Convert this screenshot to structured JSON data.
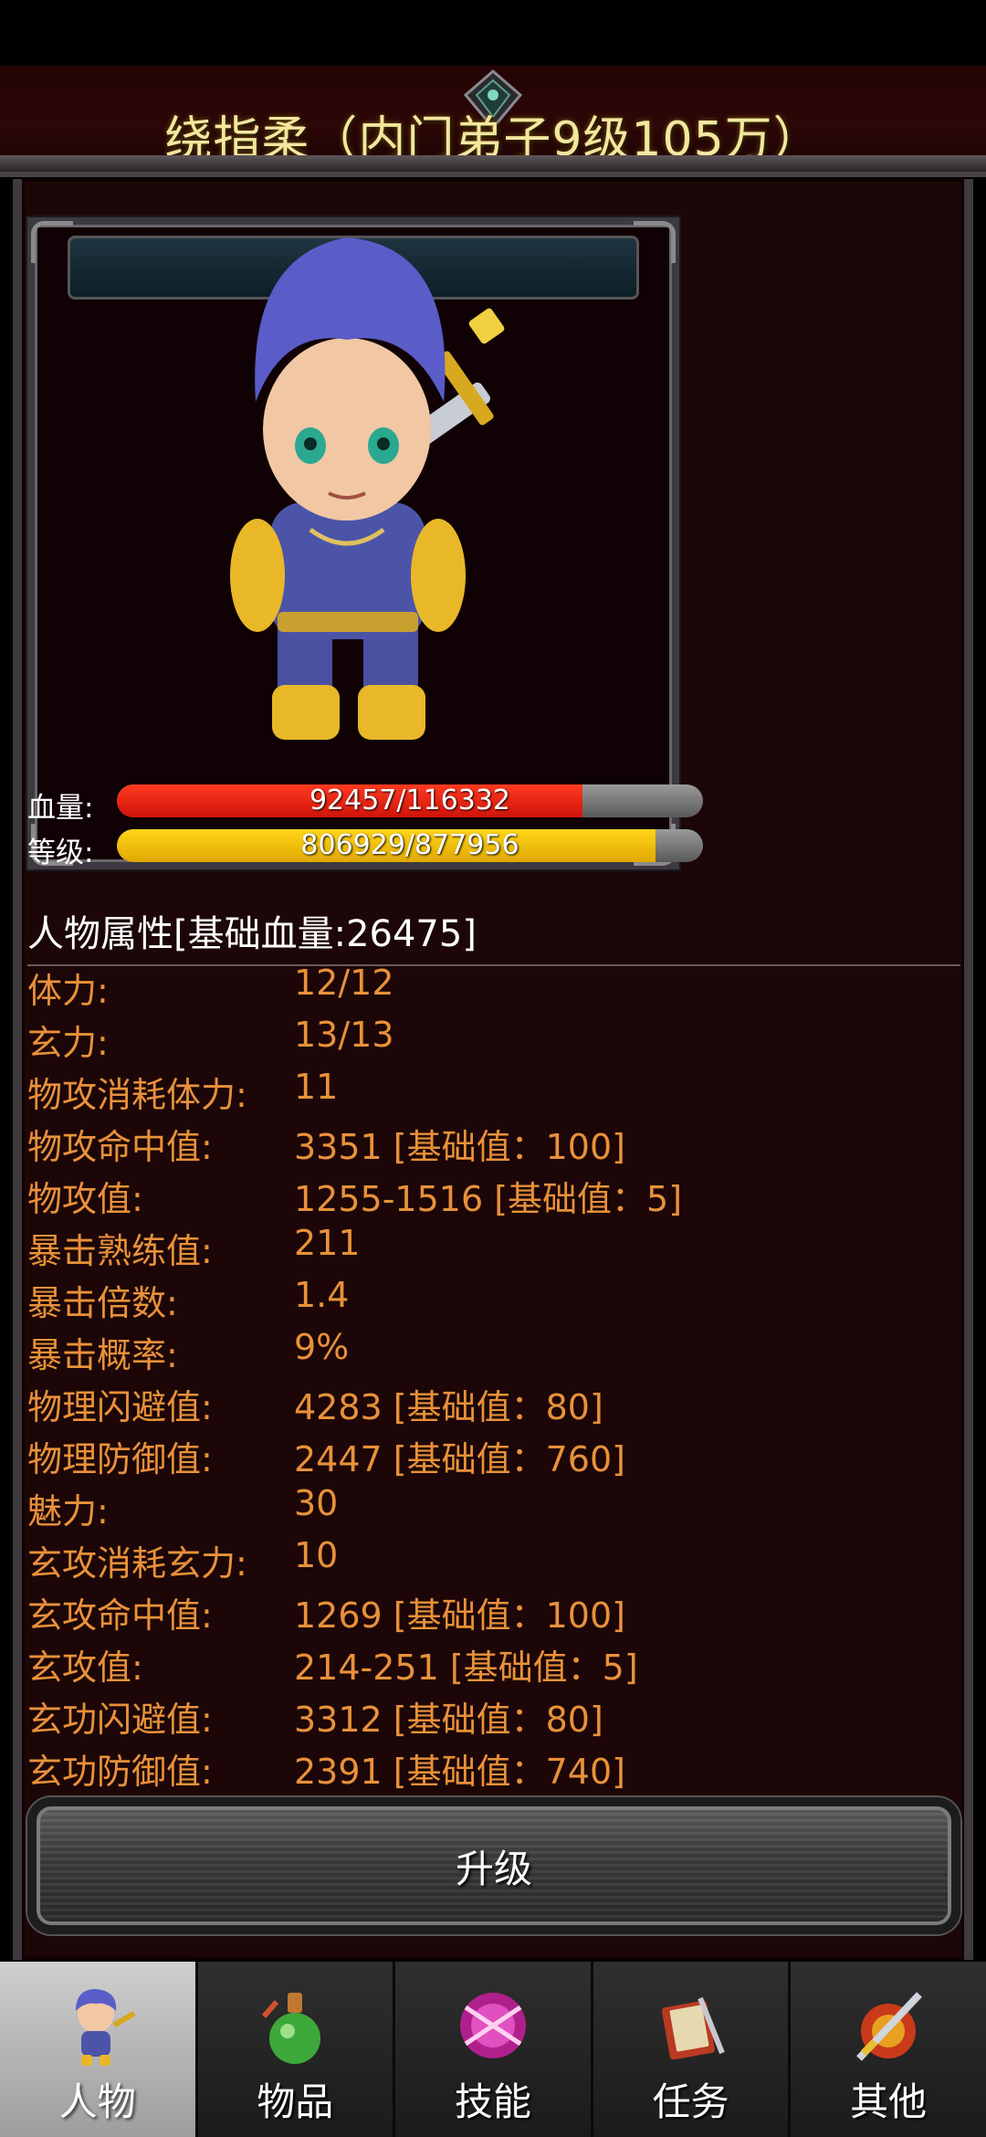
{
  "header": {
    "title": "绕指柔（内门弟子9级105万）"
  },
  "stats": {
    "hp_label": "血量:",
    "hp_text": "92457/116332",
    "hp_fraction": 0.7948,
    "level_label": "等级:",
    "level_text": "806929/877956",
    "level_fraction": 0.9191
  },
  "attributes": {
    "header": "人物属性[基础血量:26475]",
    "rows": [
      {
        "name": "体力:",
        "value": "12/12"
      },
      {
        "name": "玄力:",
        "value": "13/13"
      },
      {
        "name": "物攻消耗体力:",
        "value": "11"
      },
      {
        "name": "物攻命中值:",
        "value": "3351 [基础值：100]"
      },
      {
        "name": "物攻值:",
        "value": "1255-1516 [基础值：5]"
      },
      {
        "name": "暴击熟练值:",
        "value": "211"
      },
      {
        "name": "暴击倍数:",
        "value": "1.4"
      },
      {
        "name": "暴击概率:",
        "value": "9%"
      },
      {
        "name": "物理闪避值:",
        "value": "4283 [基础值：80]"
      },
      {
        "name": "物理防御值:",
        "value": "2447 [基础值：760]"
      },
      {
        "name": "魅力:",
        "value": "30"
      },
      {
        "name": "玄攻消耗玄力:",
        "value": "10"
      },
      {
        "name": "玄攻命中值:",
        "value": "1269 [基础值：100]"
      },
      {
        "name": "玄攻值:",
        "value": "214-251 [基础值：5]"
      },
      {
        "name": "玄功闪避值:",
        "value": "3312 [基础值：80]"
      },
      {
        "name": "玄功防御值:",
        "value": "2391 [基础值：740]"
      }
    ]
  },
  "upgrade_button": "升级",
  "nav": {
    "active_index": 0,
    "items": [
      {
        "label": "人物",
        "icon": "character-icon"
      },
      {
        "label": "物品",
        "icon": "potion-icon"
      },
      {
        "label": "技能",
        "icon": "skill-orb-icon"
      },
      {
        "label": "任务",
        "icon": "quest-book-icon"
      },
      {
        "label": "其他",
        "icon": "sword-shield-icon"
      }
    ]
  },
  "colors": {
    "title": "#f3e7a0",
    "attribute_text": "#e8913a",
    "hp_bar": "#e01e10",
    "level_bar": "#f2c200",
    "panel_bg": "#1c0607"
  }
}
